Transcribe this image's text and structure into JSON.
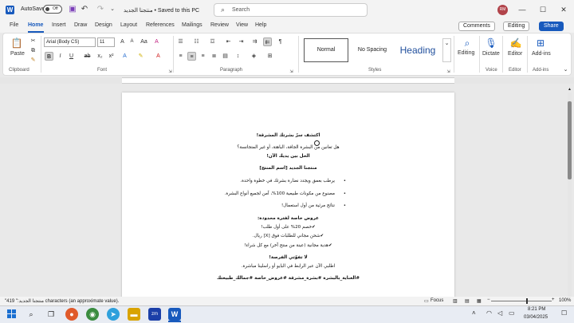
{
  "titlebar": {
    "autosave_label": "AutoSave",
    "autosave_state": "Off",
    "doc_title": "منتجنا الجديد • Saved to this PC",
    "search_placeholder": "Search",
    "user_initials": "RM"
  },
  "menu": {
    "tabs": [
      "File",
      "Home",
      "Insert",
      "Draw",
      "Design",
      "Layout",
      "References",
      "Mailings",
      "Review",
      "View",
      "Help"
    ],
    "active": "Home",
    "comments_label": "Comments",
    "editing_label": "Editing",
    "share_label": "Share"
  },
  "ribbon": {
    "paste_label": "Paste",
    "clipboard_label": "Clipboard",
    "font_name": "Arial (Body CS)",
    "font_size": "11",
    "font_label": "Font",
    "paragraph_label": "Paragraph",
    "styles": [
      "Normal",
      "No Spacing",
      "Heading"
    ],
    "styles_label": "Styles",
    "editing_btn": "Editing",
    "dictate_btn": "Dictate",
    "voice_label": "Voice",
    "editor_btn": "Editor",
    "editor_label": "Editor",
    "addins_btn": "Add-ins",
    "addins_label": "Add-ins"
  },
  "document": {
    "lines": [
      "اكتشف سرّ بشرتك المشرقة!",
      "هل تعانين من البشرة الجافة، الباهتة، أو غير المتجانسة؟",
      "الحل بين يديك الآن!",
      "منتجنا الجديد [اسم المنتج]",
      "يرطب بعمق ويجدد نضارة بشرتك في خطوة واحدة.",
      "مصنوع من مكونات طبيعية 100%، آمن لجميع أنواع البشرة.",
      "نتائج مرئية من أول استعمال!",
      "عروض خاصة لفترة محدودة:",
      "✔خصم 20% على أول طلب!",
      "✔شحن مجاني للطلبات فوق [X] ريال.",
      "✔هدية مجانية (عينة من منتج آخر) مع كل شراء!",
      "لا تفوّتي الفرصة!",
      "اطلبي الآن عبر الرابط في البايو أو راسلينا مباشرة.",
      "#العناية_بالبشرة #بشرة_مشرقة #عروض_خاصة #جمالك_طبيعتك"
    ]
  },
  "status": {
    "word_count": "\"منتجنا الجديد:\" 419 characters (an approximate value).",
    "focus_label": "Focus",
    "zoom": "100%"
  },
  "taskbar": {
    "time": "8:21 PM",
    "date": "03/04/2025"
  },
  "colors": {
    "accent": "#185abd",
    "avatar": "#b1434a"
  }
}
